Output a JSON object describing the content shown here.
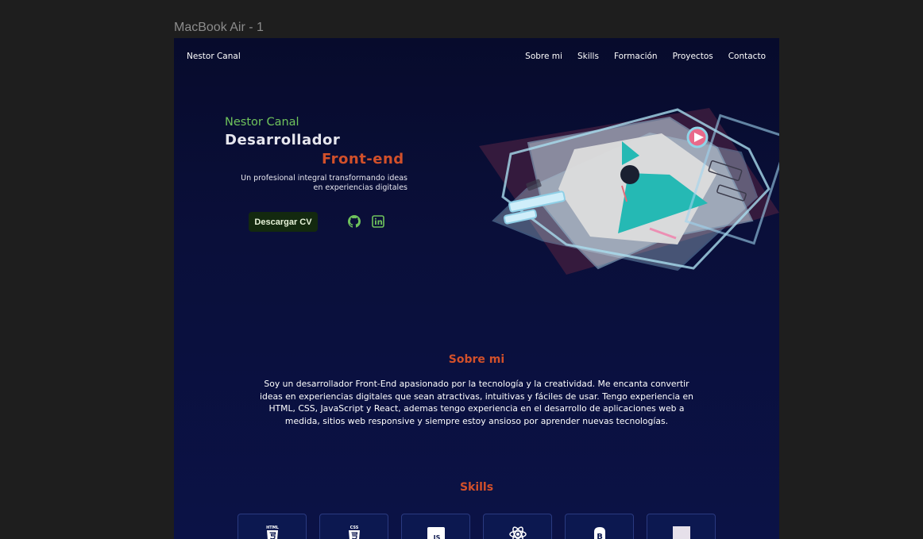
{
  "frame": {
    "label": "MacBook Air - 1"
  },
  "nav": {
    "brand": "Nestor Canal",
    "links": [
      "Sobre mi",
      "Skills",
      "Formación",
      "Proyectos",
      "Contacto"
    ]
  },
  "hero": {
    "name": "Nestor Canal",
    "role_line1": "Desarrollador",
    "role_line2": "Front-end",
    "tagline_line1": "Un profesional integral transformando ideas",
    "tagline_line2": "en experiencias digitales",
    "cv_button": "Descargar CV",
    "social_icons": [
      "github-icon",
      "linkedin-icon"
    ]
  },
  "about": {
    "title": "Sobre mi",
    "text": "Soy un desarrollador Front-End apasionado por la tecnología y la creatividad. Me encanta convertir ideas en experiencias digitales que sean atractivas, intuitivas y fáciles de usar. Tengo experiencia en HTML, CSS, JavaScript y React, ademas tengo experiencia en el desarrollo de aplicaciones web a medida, sitios web responsive y siempre estoy ansioso por aprender nuevas tecnologías."
  },
  "skills": {
    "title": "Skills",
    "items": [
      {
        "icon": "html5-icon",
        "label": "HTML"
      },
      {
        "icon": "css3-icon",
        "label": "CSS"
      },
      {
        "icon": "javascript-icon",
        "label": "JS"
      },
      {
        "icon": "react-icon"
      },
      {
        "icon": "bootstrap-icon",
        "label": "B"
      },
      {
        "icon": "blank-icon"
      }
    ]
  },
  "colors": {
    "accent_green": "#6fc35c",
    "accent_orange": "#d2502a",
    "background": "#0a0f3a"
  }
}
